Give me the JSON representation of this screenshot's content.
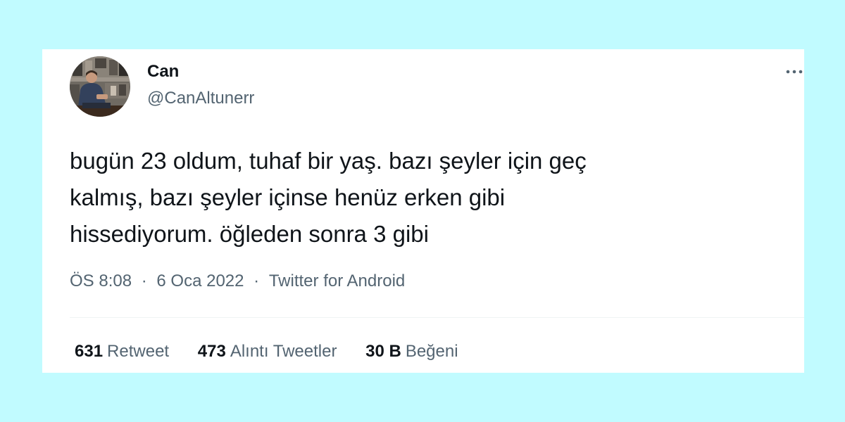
{
  "background_color": "#c1fbff",
  "tweet": {
    "author": {
      "display_name": "Can",
      "handle": "@CanAltunerr"
    },
    "more_icon": "more-horizontal-icon",
    "text_lines": [
      "bugün 23 oldum, tuhaf bir yaş. bazı şeyler için geç",
      "kalmış, bazı şeyler içinse henüz erken gibi",
      "hissediyorum. öğleden sonra 3 gibi"
    ],
    "meta": {
      "time": "ÖS 8:08",
      "separator": "·",
      "date": "6 Oca 2022",
      "source": "Twitter for Android"
    },
    "stats": [
      {
        "count": "631",
        "label": "Retweet"
      },
      {
        "count": "473",
        "label": "Alıntı Tweetler"
      },
      {
        "count": "30 B",
        "label": "Beğeni"
      }
    ]
  }
}
